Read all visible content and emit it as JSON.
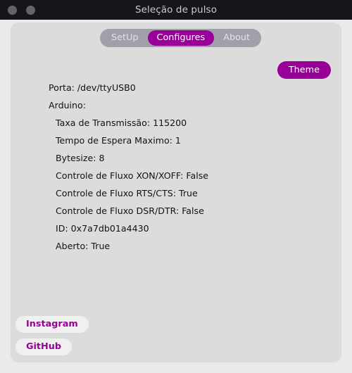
{
  "window": {
    "title": "Seleção de pulso",
    "controls": [
      {
        "name": "window-dot-close"
      },
      {
        "name": "window-dot-minimize"
      }
    ]
  },
  "tabs": [
    {
      "label": "SetUp",
      "active": false
    },
    {
      "label": "Configures",
      "active": true
    },
    {
      "label": "About",
      "active": false
    }
  ],
  "toolbar": {
    "theme_label": "Theme"
  },
  "info": {
    "lines": [
      {
        "text": "Porta: /dev/ttyUSB0",
        "indent": false
      },
      {
        "text": "Arduino:",
        "indent": false
      },
      {
        "text": "Taxa de Transmissão: 115200",
        "indent": true
      },
      {
        "text": "Tempo de Espera Maximo: 1",
        "indent": true
      },
      {
        "text": "Bytesize: 8",
        "indent": true
      },
      {
        "text": "Controle de Fluxo XON/XOFF: False",
        "indent": true
      },
      {
        "text": "Controle de Fluxo RTS/CTS: True",
        "indent": true
      },
      {
        "text": "Controle de Fluxo DSR/DTR: False",
        "indent": true
      },
      {
        "text": "ID: 0x7a7db01a4430",
        "indent": true
      },
      {
        "text": "Aberto: True",
        "indent": true
      }
    ]
  },
  "social": [
    {
      "label": "Instagram"
    },
    {
      "label": "GitHub"
    }
  ],
  "colors": {
    "accent": "#990099",
    "titlebar_bg": "#15151a",
    "panel_bg": "#dcdcdc",
    "window_bg": "#eaeaea",
    "tabbar_bg": "#a0a0a8",
    "social_bg": "#f0f0f0",
    "text": "#121212"
  }
}
